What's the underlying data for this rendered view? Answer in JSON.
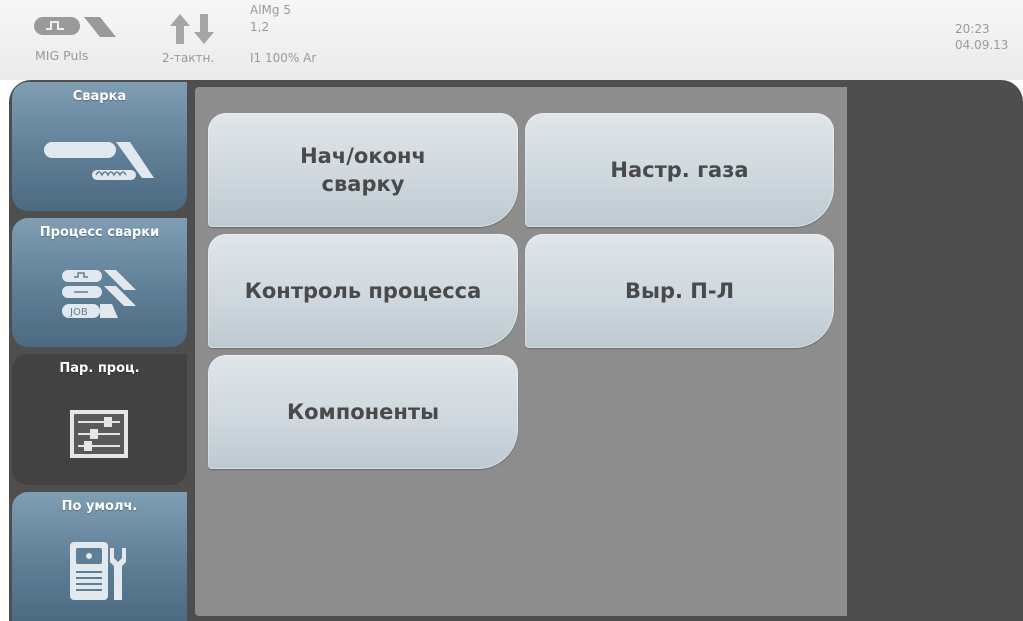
{
  "status": {
    "process": "MIG Puls",
    "mode": "2-тактн.",
    "material": "AlMg 5",
    "wire_dia": "1,2",
    "gas": "I1 100% Ar",
    "time": "20:23",
    "date": "04.09.13"
  },
  "sidebar": {
    "tabs": [
      {
        "label": "Сварка",
        "icon": "welding-torch-icon"
      },
      {
        "label": "Процесс сварки",
        "icon": "process-job-icon"
      },
      {
        "label": "Пар. проц.",
        "icon": "sliders-icon"
      },
      {
        "label": "По умолч.",
        "icon": "machine-wrench-icon"
      }
    ]
  },
  "menu": {
    "buttons": [
      {
        "label": "Нач/оконч\nсварку"
      },
      {
        "label": "Настр. газа"
      },
      {
        "label": "Контроль процесса"
      },
      {
        "label": "Выр. П-Л"
      },
      {
        "label": "Компоненты"
      }
    ]
  },
  "colors": {
    "tab_blue": "#6a8aa2",
    "tab_active": "#424242",
    "frame": "#4e4e4e",
    "panel": "#8d8d8d",
    "button": "#d4dde2"
  }
}
